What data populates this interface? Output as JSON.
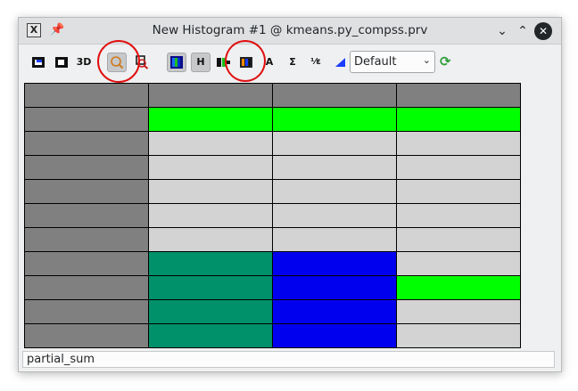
{
  "window": {
    "title": "New Histogram #1 @ kmeans.py_compss.prv",
    "app_icon": "X",
    "pin_icon": "📌",
    "min_glyph": "⌄",
    "max_glyph": "⌃",
    "close_glyph": "✕"
  },
  "toolbar": {
    "btn_3d_label": "3D",
    "btn_h_label": "H",
    "btn_sigma_label": "Σ",
    "btn_fraction_label": "⅟ε",
    "btn_label_icon": "A",
    "colormap_select": {
      "value": "Default",
      "arrow": "⌄"
    },
    "refresh_icon": "⟳"
  },
  "histogram": {
    "colors": {
      "gray": "#808080",
      "light": "#d3d3d3",
      "green": "#00ff00",
      "teal": "#00906a",
      "blue": "#0000ee"
    },
    "rows": [
      [
        "gray",
        "gray",
        "gray",
        "gray"
      ],
      [
        "gray",
        "green",
        "green",
        "green"
      ],
      [
        "gray",
        "light",
        "light",
        "light"
      ],
      [
        "gray",
        "light",
        "light",
        "light"
      ],
      [
        "gray",
        "light",
        "light",
        "light"
      ],
      [
        "gray",
        "light",
        "light",
        "light"
      ],
      [
        "gray",
        "light",
        "light",
        "light"
      ],
      [
        "gray",
        "teal",
        "blue",
        "light"
      ],
      [
        "gray",
        "teal",
        "blue",
        "green"
      ],
      [
        "gray",
        "teal",
        "blue",
        "light"
      ],
      [
        "gray",
        "teal",
        "blue",
        "light"
      ]
    ]
  },
  "status": {
    "text": "partial_sum"
  }
}
